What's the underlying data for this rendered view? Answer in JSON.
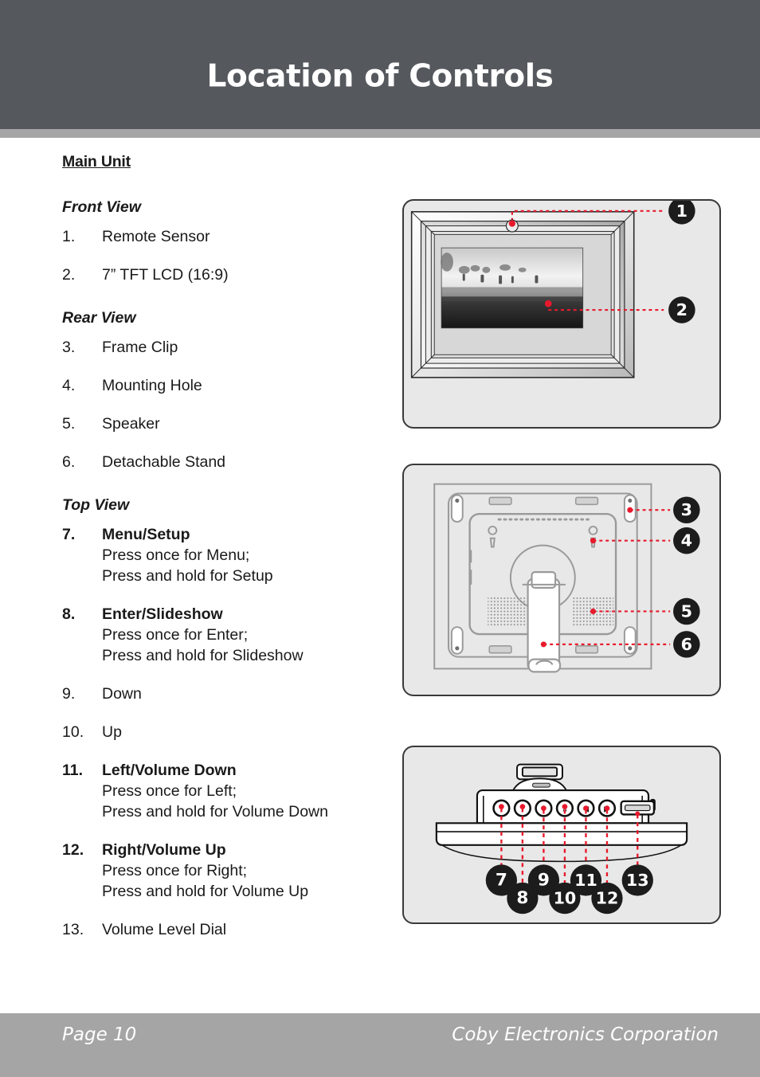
{
  "header": {
    "title": "Location of Controls"
  },
  "footer": {
    "page_label": "Page 10",
    "corporation": "Coby Electronics Corporation"
  },
  "content": {
    "section_title": "Main Unit",
    "groups": [
      {
        "subhead": "Front View",
        "items": [
          {
            "num": "1.",
            "label": "Remote Sensor",
            "bold": false,
            "sub": ""
          },
          {
            "num": "2.",
            "label": "7”  TFT LCD (16:9)",
            "bold": false,
            "sub": ""
          }
        ]
      },
      {
        "subhead": "Rear View",
        "items": [
          {
            "num": "3.",
            "label": "Frame Clip",
            "bold": false,
            "sub": ""
          },
          {
            "num": "4.",
            "label": "Mounting Hole",
            "bold": false,
            "sub": ""
          },
          {
            "num": "5.",
            "label": "Speaker",
            "bold": false,
            "sub": ""
          },
          {
            "num": "6.",
            "label": "Detachable Stand",
            "bold": false,
            "sub": ""
          }
        ]
      },
      {
        "subhead": "Top View",
        "items": [
          {
            "num": "7.",
            "label": "Menu/Setup",
            "bold": true,
            "sub": "Press once for Menu;\nPress and hold for Setup"
          },
          {
            "num": "8.",
            "label": "Enter/Slideshow",
            "bold": true,
            "sub": "Press once for Enter;\nPress and hold for Slideshow"
          },
          {
            "num": "9.",
            "label": "Down",
            "bold": false,
            "sub": ""
          },
          {
            "num": "10.",
            "label": "Up",
            "bold": false,
            "sub": ""
          },
          {
            "num": "11.",
            "label": "Left/Volume Down",
            "bold": true,
            "sub": "Press once for Left;\nPress and hold for Volume Down"
          },
          {
            "num": "12.",
            "label": "Right/Volume Up",
            "bold": true,
            "sub": "Press once for Right;\nPress and hold for Volume Up"
          },
          {
            "num": "13.",
            "label": "Volume Level Dial",
            "bold": false,
            "sub": ""
          }
        ]
      }
    ]
  },
  "figures": {
    "front": {
      "name": "Front View",
      "callouts": [
        {
          "number": "1",
          "target": "Remote Sensor"
        },
        {
          "number": "2",
          "target": "7” TFT LCD (16:9)"
        }
      ]
    },
    "rear": {
      "name": "Rear View",
      "callouts": [
        {
          "number": "3",
          "target": "Frame Clip"
        },
        {
          "number": "4",
          "target": "Mounting Hole"
        },
        {
          "number": "5",
          "target": "Speaker"
        },
        {
          "number": "6",
          "target": "Detachable Stand"
        }
      ]
    },
    "top": {
      "name": "Top View",
      "callouts": [
        {
          "number": "7",
          "target": "Menu/Setup"
        },
        {
          "number": "8",
          "target": "Enter/Slideshow"
        },
        {
          "number": "9",
          "target": "Down"
        },
        {
          "number": "10",
          "target": "Up"
        },
        {
          "number": "11",
          "target": "Left/Volume Down"
        },
        {
          "number": "12",
          "target": "Right/Volume Up"
        },
        {
          "number": "13",
          "target": "Volume Level Dial"
        }
      ]
    }
  },
  "colors": {
    "header_bar": "#55585d",
    "rule_bar": "#a5a5a5",
    "footer_bar": "#a5a5a5",
    "figure_bg": "#e8e8e8",
    "callout_fill": "#1c1c1c",
    "leader_line": "#e8192c",
    "text": "#1a1a1a"
  }
}
